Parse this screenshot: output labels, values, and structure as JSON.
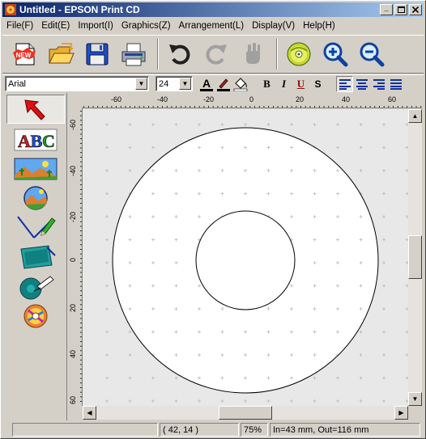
{
  "window": {
    "title": "Untitled - EPSON Print CD",
    "minimize": "_",
    "maximize": "□",
    "close": "×"
  },
  "menu": [
    "File(F)",
    "Edit(E)",
    "Import(I)",
    "Graphics(Z)",
    "Arrangement(L)",
    "Display(V)",
    "Help(H)"
  ],
  "toolbar": {
    "new_label": "NEW",
    "icons": [
      "new-file-icon",
      "open-folder-icon",
      "save-disk-icon",
      "printer-icon",
      "undo-icon",
      "redo-icon",
      "clear-icon",
      "cd-icon",
      "zoom-in-icon",
      "zoom-out-icon"
    ]
  },
  "format": {
    "font_name": "Arial",
    "font_size": "24",
    "bold": "B",
    "italic": "I",
    "underline": "U",
    "strikeout": "S",
    "color_a": "A"
  },
  "palette": {
    "text_label": "ABC",
    "items": [
      "select-arrow-icon",
      "text-tool-icon",
      "image-tool-icon",
      "circle-image-tool-icon",
      "line-tool-icon",
      "shape-tool-icon",
      "circle-tool-icon",
      "cd-background-icon"
    ]
  },
  "rulers": {
    "h_labels": [
      "-60",
      "-40",
      "-20",
      "0",
      "20",
      "40",
      "60"
    ],
    "v_labels": [
      "-60",
      "-40",
      "-20",
      "0",
      "20",
      "40",
      "60"
    ]
  },
  "status": {
    "coords": "(  42,  14 )",
    "zoom": "75%",
    "diameter": "In=43 mm, Out=116 mm"
  },
  "colors": {
    "title_start": "#0a246a",
    "title_end": "#a6caf0",
    "chrome": "#d4d0c8",
    "canvas": "#e8e8e8"
  }
}
